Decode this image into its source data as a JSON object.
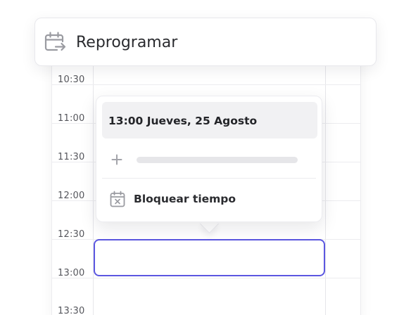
{
  "header": {
    "title": "Reprogramar",
    "icon": "calendar-reschedule-icon"
  },
  "calendar": {
    "times": [
      "10:30",
      "11:00",
      "11:30",
      "12:00",
      "12:30",
      "13:00",
      "13:30"
    ]
  },
  "popup": {
    "date_label": "13:00 Jueves, 25 Agosto",
    "add_icon": "plus-icon",
    "block_label": "Bloquear tiempo",
    "block_icon": "calendar-x-icon"
  },
  "colors": {
    "accent": "#5b57e0",
    "text": "#2a2b2f",
    "muted": "#9a9ba1"
  }
}
